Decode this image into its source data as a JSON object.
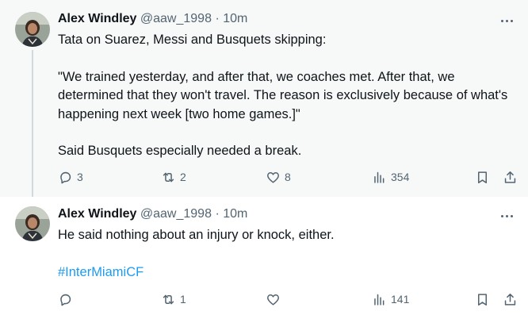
{
  "tweets": [
    {
      "author_name": "Alex Windley",
      "handle": "@aaw_1998",
      "separator": "·",
      "time": "10m",
      "paragraphs": [
        "Tata on Suarez, Messi and Busquets skipping:",
        "\"We trained yesterday, and after that, we coaches met. After that, we determined that they won't travel. The reason is exclusively because of what's happening next week [two home games.]\"",
        "Said Busquets especially needed a break."
      ],
      "replies": "3",
      "reposts": "2",
      "likes": "8",
      "views": "354"
    },
    {
      "author_name": "Alex Windley",
      "handle": "@aaw_1998",
      "separator": "·",
      "time": "10m",
      "paragraphs": [
        "He said nothing about an injury or knock, either."
      ],
      "hashtag": "#InterMiamiCF",
      "replies": "",
      "reposts": "1",
      "likes": "",
      "views": "141"
    }
  ],
  "colors": {
    "text": "#0f1419",
    "secondary": "#536471",
    "link": "#1d9bf0",
    "hover_bg": "#f7f9f9"
  },
  "icons": [
    "reply-icon",
    "repost-icon",
    "like-icon",
    "views-icon",
    "bookmark-icon",
    "share-icon",
    "more-icon"
  ]
}
